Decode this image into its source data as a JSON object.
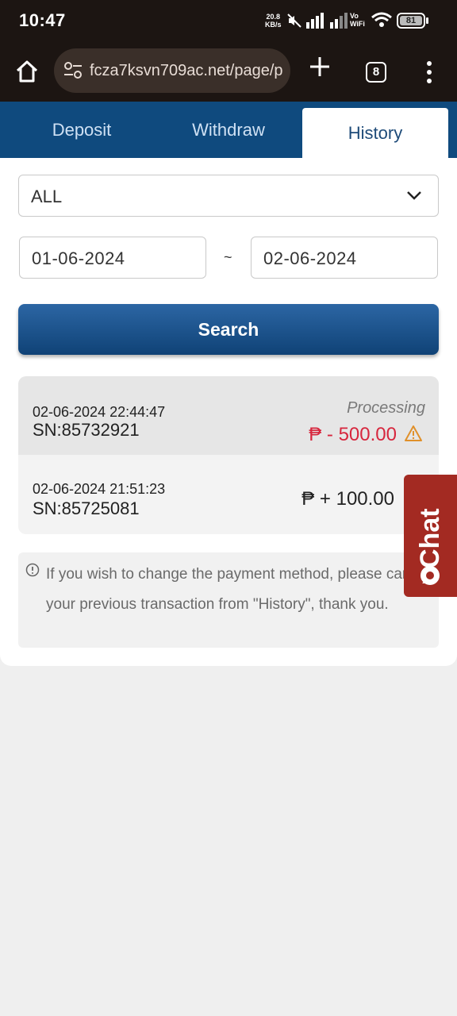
{
  "status_bar": {
    "time": "10:47",
    "net_speed_value": "20.8",
    "net_speed_unit": "KB/s",
    "vowifi_line1": "Vo",
    "vowifi_line2": "WiFi",
    "battery": "81"
  },
  "browser": {
    "url": "fcza7ksvn709ac.net/page/p",
    "tab_count": "8"
  },
  "tabs": [
    {
      "label": "Deposit",
      "active": false
    },
    {
      "label": "Withdraw",
      "active": false
    },
    {
      "label": "History",
      "active": true
    }
  ],
  "filter": {
    "type_value": "ALL",
    "date_from": "01-06-2024",
    "date_separator": "~",
    "date_to": "02-06-2024",
    "search_label": "Search"
  },
  "records": [
    {
      "datetime": "02-06-2024 22:44:47",
      "sn": "SN:85732921",
      "status": "Processing",
      "amount": "₱ - 500.00",
      "amount_color": "#d7263d"
    },
    {
      "datetime": "02-06-2024 21:51:23",
      "sn": "SN:85725081",
      "status": "",
      "amount": "₱ + 100.00",
      "amount_color": "#222222"
    }
  ],
  "notice": {
    "text": "If you wish to change the payment method, please cancel your previous transaction from \"History\", thank you."
  },
  "chat": {
    "label": "Chat"
  },
  "colors": {
    "primary": "#0f4a7e",
    "danger": "#d7263d",
    "warning": "#e0902a",
    "success": "#3ea84a",
    "chat": "#a32a22"
  }
}
